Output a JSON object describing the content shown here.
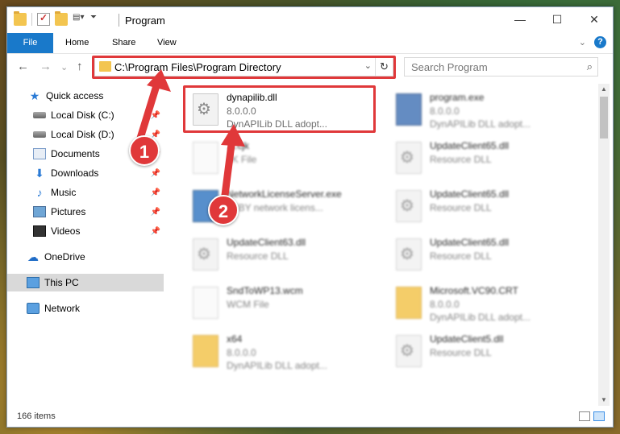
{
  "window": {
    "title": "Program",
    "controls": {
      "minimize": "—",
      "maximize": "☐",
      "close": "✕"
    }
  },
  "ribbon": {
    "tabs": [
      "File",
      "Home",
      "Share",
      "View"
    ]
  },
  "nav": {
    "back": "←",
    "forward": "→",
    "dropdown": "⌄",
    "up": "↑",
    "address": "C:\\Program Files\\Program Directory",
    "search_placeholder": "Search Program"
  },
  "sidebar": {
    "items": [
      {
        "label": "Quick access",
        "icon": "star-icon",
        "pinned": false
      },
      {
        "label": "Local Disk (C:)",
        "icon": "disk-icon",
        "pinned": true
      },
      {
        "label": "Local Disk (D:)",
        "icon": "disk-icon",
        "pinned": true
      },
      {
        "label": "Documents",
        "icon": "documents-icon",
        "pinned": true
      },
      {
        "label": "Downloads",
        "icon": "downloads-icon",
        "pinned": true
      },
      {
        "label": "Music",
        "icon": "music-icon",
        "pinned": true
      },
      {
        "label": "Pictures",
        "icon": "pictures-icon",
        "pinned": true
      },
      {
        "label": "Videos",
        "icon": "videos-icon",
        "pinned": true
      },
      {
        "label": "OneDrive",
        "icon": "cloud-icon",
        "pinned": false
      },
      {
        "label": "This PC",
        "icon": "pc-icon",
        "pinned": false,
        "selected": true
      },
      {
        "label": "Network",
        "icon": "network-icon",
        "pinned": false
      }
    ]
  },
  "files": [
    {
      "name": "dynapilib.dll",
      "line2": "8.0.0.0",
      "line3": "DynAPILib DLL adopt...",
      "icon": "dll",
      "highlighted": true
    },
    {
      "name": "program.exe",
      "line2": "8.0.0.0",
      "line3": "DynAPILib DLL adopt...",
      "icon": "exe"
    },
    {
      "name": "..t.cjk",
      "line2": "..K File",
      "line3": "",
      "icon": "blank"
    },
    {
      "name": "UpdateClient65.dll",
      "line2": "Resource DLL",
      "line3": "",
      "icon": "dll"
    },
    {
      "name": "NetworkLicenseServer.exe",
      "line2": "..BBY network licens...",
      "line3": "",
      "icon": "net"
    },
    {
      "name": "UpdateClient65.dll",
      "line2": "Resource DLL",
      "line3": "",
      "icon": "dll"
    },
    {
      "name": "UpdateClient63.dll",
      "line2": "Resource DLL",
      "line3": "",
      "icon": "dll"
    },
    {
      "name": "UpdateClient65.dll",
      "line2": "Resource DLL",
      "line3": "",
      "icon": "dll"
    },
    {
      "name": "SndToWP13.wcm",
      "line2": "WCM File",
      "line3": "",
      "icon": "blank"
    },
    {
      "name": "Microsoft.VC90.CRT",
      "line2": "8.0.0.0",
      "line3": "DynAPILib DLL adopt...",
      "icon": "folder"
    },
    {
      "name": "x64",
      "line2": "8.0.0.0",
      "line3": "DynAPILib DLL adopt...",
      "icon": "folder"
    },
    {
      "name": "UpdateClient5.dll",
      "line2": "Resource DLL",
      "line3": "",
      "icon": "dll"
    }
  ],
  "status": {
    "items_count": "166 items"
  },
  "callouts": [
    {
      "label": "1"
    },
    {
      "label": "2"
    }
  ],
  "colors": {
    "accent": "#1979ca",
    "highlight_red": "#e0383a"
  }
}
